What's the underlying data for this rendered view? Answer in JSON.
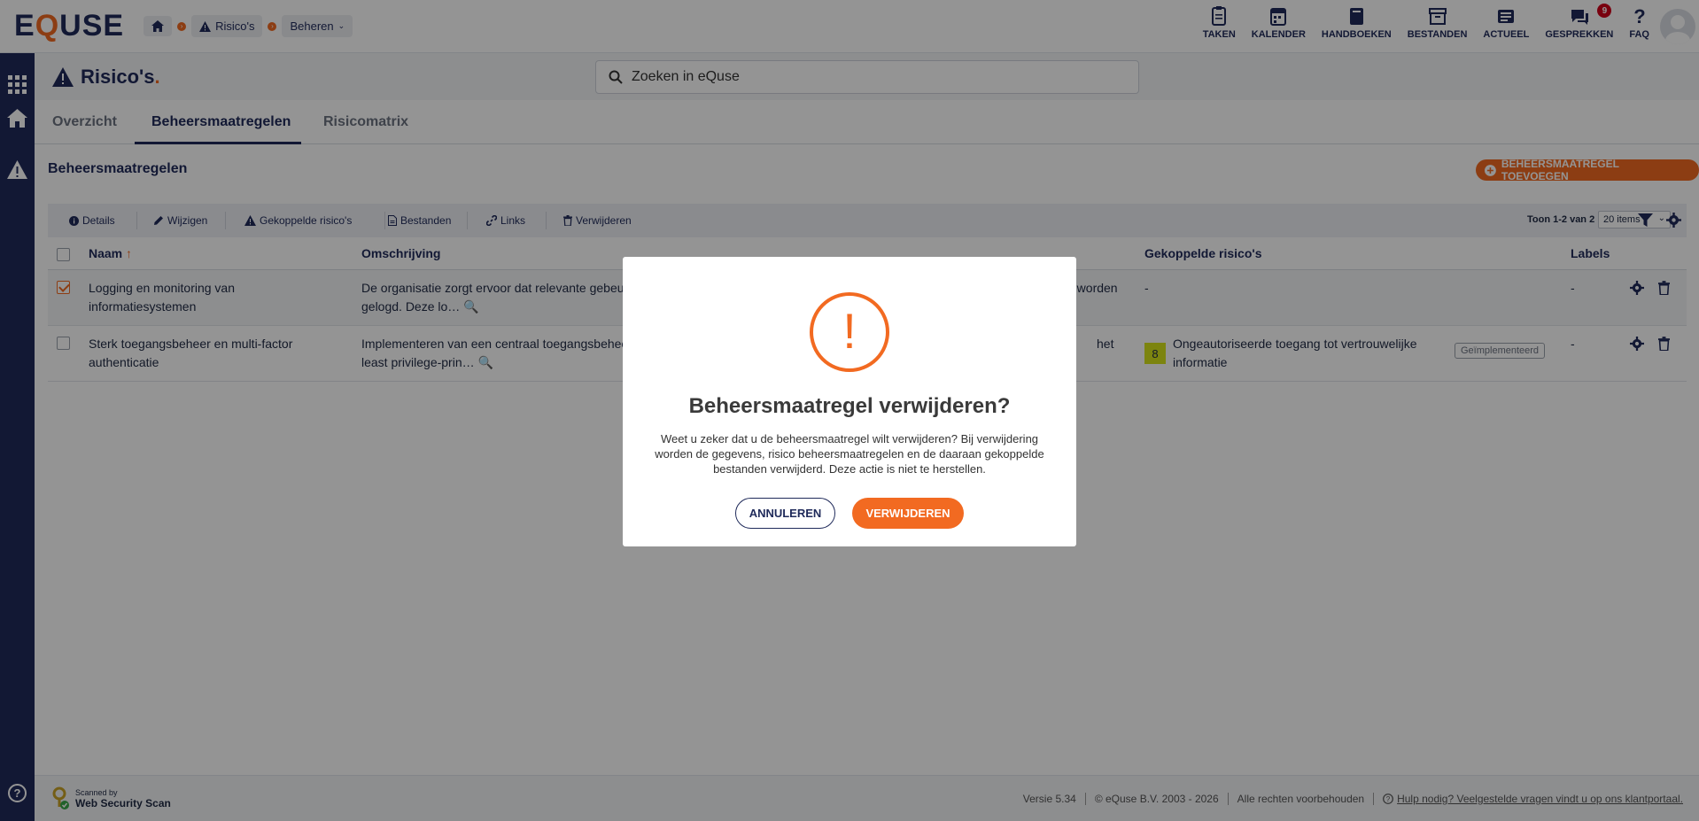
{
  "app": {
    "logo_pre": "E",
    "logo_q": "Q",
    "logo_post": "USE"
  },
  "breadcrumb": {
    "item1": "Risico's",
    "item2": "Beheren"
  },
  "topnav": [
    {
      "label": "TAKEN",
      "icon": "clipboard-icon"
    },
    {
      "label": "KALENDER",
      "icon": "calendar-icon"
    },
    {
      "label": "HANDBOEKEN",
      "icon": "book-icon"
    },
    {
      "label": "BESTANDEN",
      "icon": "archive-icon"
    },
    {
      "label": "ACTUEEL",
      "icon": "newspaper-icon"
    },
    {
      "label": "GESPREKKEN",
      "icon": "chat-icon",
      "badge": "9"
    },
    {
      "label": "FAQ",
      "icon": "question-icon"
    }
  ],
  "page": {
    "title": "Risico's",
    "title_dot": "."
  },
  "search": {
    "placeholder": "Zoeken in eQuse"
  },
  "tabs": [
    "Overzicht",
    "Beheersmaatregelen",
    "Risicomatrix"
  ],
  "section": {
    "title": "Beheersmaatregelen",
    "add_label": "BEHEERSMAATREGEL TOEVOEGEN"
  },
  "toolbar": {
    "details": "Details",
    "edit": "Wijzigen",
    "linked": "Gekoppelde risico's",
    "files": "Bestanden",
    "links": "Links",
    "delete": "Verwijderen",
    "pageinfo": "Toon 1-2 van 2",
    "perpage": "20 items"
  },
  "table": {
    "headers": {
      "name": "Naam",
      "desc": "Omschrijving",
      "linked": "Gekoppelde risico's",
      "labels": "Labels"
    },
    "rows": [
      {
        "name_l1": "Logging en monitoring van",
        "name_l2": "informatiesystemen",
        "desc_l1": "De organisatie zorgt ervoor dat relevante gebeu",
        "desc_l1_end": "n worden",
        "desc_l2": "gelogd. Deze lo…",
        "linked": "-",
        "labels": "-",
        "checked": true
      },
      {
        "name_l1": "Sterk toegangsbeheer en multi-factor",
        "name_l2": "authenticatie",
        "desc_l1": "Implementeren van een centraal toegangsbehee",
        "desc_l1_end": "het",
        "desc_l2": "least privilege-prin…",
        "score": "8",
        "linked_l1": "Ongeautoriseerde toegang tot vertrouwelijke",
        "linked_l2": "informatie",
        "status": "Geïmplementeerd",
        "labels": "-",
        "checked": false
      }
    ]
  },
  "footer": {
    "scanned_by": "Scanned by",
    "scan_name": "Web Security Scan",
    "version": "Versie 5.34",
    "copyright": "© eQuse B.V. 2003 - 2026",
    "rights": "Alle rechten voorbehouden",
    "help": "Hulp nodig? Veelgestelde vragen vindt u op ons klantportaal."
  },
  "modal": {
    "title": "Beheersmaatregel verwijderen?",
    "body": "Weet u zeker dat u de beheersmaatregel wilt verwijderen? Bij verwijdering worden de gegevens, risico beheersmaatregelen en de daaraan gekoppelde bestanden verwijderd. Deze actie is niet te herstellen.",
    "warn_glyph": "!",
    "cancel": "ANNULEREN",
    "confirm": "VERWIJDEREN"
  },
  "colors": {
    "navy": "#1f2a5a",
    "accent": "#f26a21",
    "score_yellow": "#d6e31a"
  }
}
